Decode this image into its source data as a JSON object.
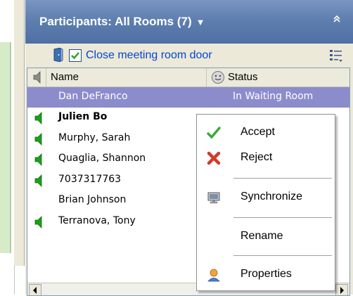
{
  "panel": {
    "title": "Participants: All Rooms (7)",
    "title_dropdown_icon": "caret-down-icon",
    "collapse_icon": "double-chevron-up-icon"
  },
  "toolbar": {
    "door_icon": "door-icon",
    "close_door_checked": true,
    "close_door_label": "Close meeting room door",
    "list_options_icon": "list-options-icon"
  },
  "list": {
    "columns": {
      "speaker_icon": "speaker-icon",
      "name": "Name",
      "status_icon": "status-face-icon",
      "status": "Status"
    },
    "rows": [
      {
        "name": "Dan DeFranco",
        "status": "In Waiting Room",
        "speaker": false,
        "selected": true,
        "bold": false
      },
      {
        "name": "Julien Bo",
        "status": "",
        "speaker": true,
        "selected": false,
        "bold": true
      },
      {
        "name": "Murphy, Sarah",
        "status": "",
        "speaker": true,
        "selected": false,
        "bold": false
      },
      {
        "name": "Quaglia, Shannon",
        "status": "",
        "speaker": true,
        "selected": false,
        "bold": false
      },
      {
        "name": "7037317763",
        "status": "",
        "speaker": true,
        "selected": false,
        "bold": false
      },
      {
        "name": "Brian Johnson",
        "status": "",
        "speaker": false,
        "selected": false,
        "bold": false
      },
      {
        "name": "Terranova, Tony",
        "status": "",
        "speaker": true,
        "selected": false,
        "bold": false
      }
    ]
  },
  "context_menu": {
    "items": [
      {
        "label": "Accept",
        "icon": "checkmark-icon"
      },
      {
        "label": "Reject",
        "icon": "red-x-icon"
      },
      {
        "label": "Synchronize",
        "icon": "monitor-icon"
      },
      {
        "label": "Rename",
        "icon": ""
      },
      {
        "label": "Properties",
        "icon": "person-icon"
      }
    ]
  },
  "colors": {
    "titlebar": "#5f7fb0",
    "selection": "#8c8ccd",
    "link_blue": "#0046d5",
    "speaker_green": "#1aa01a"
  }
}
